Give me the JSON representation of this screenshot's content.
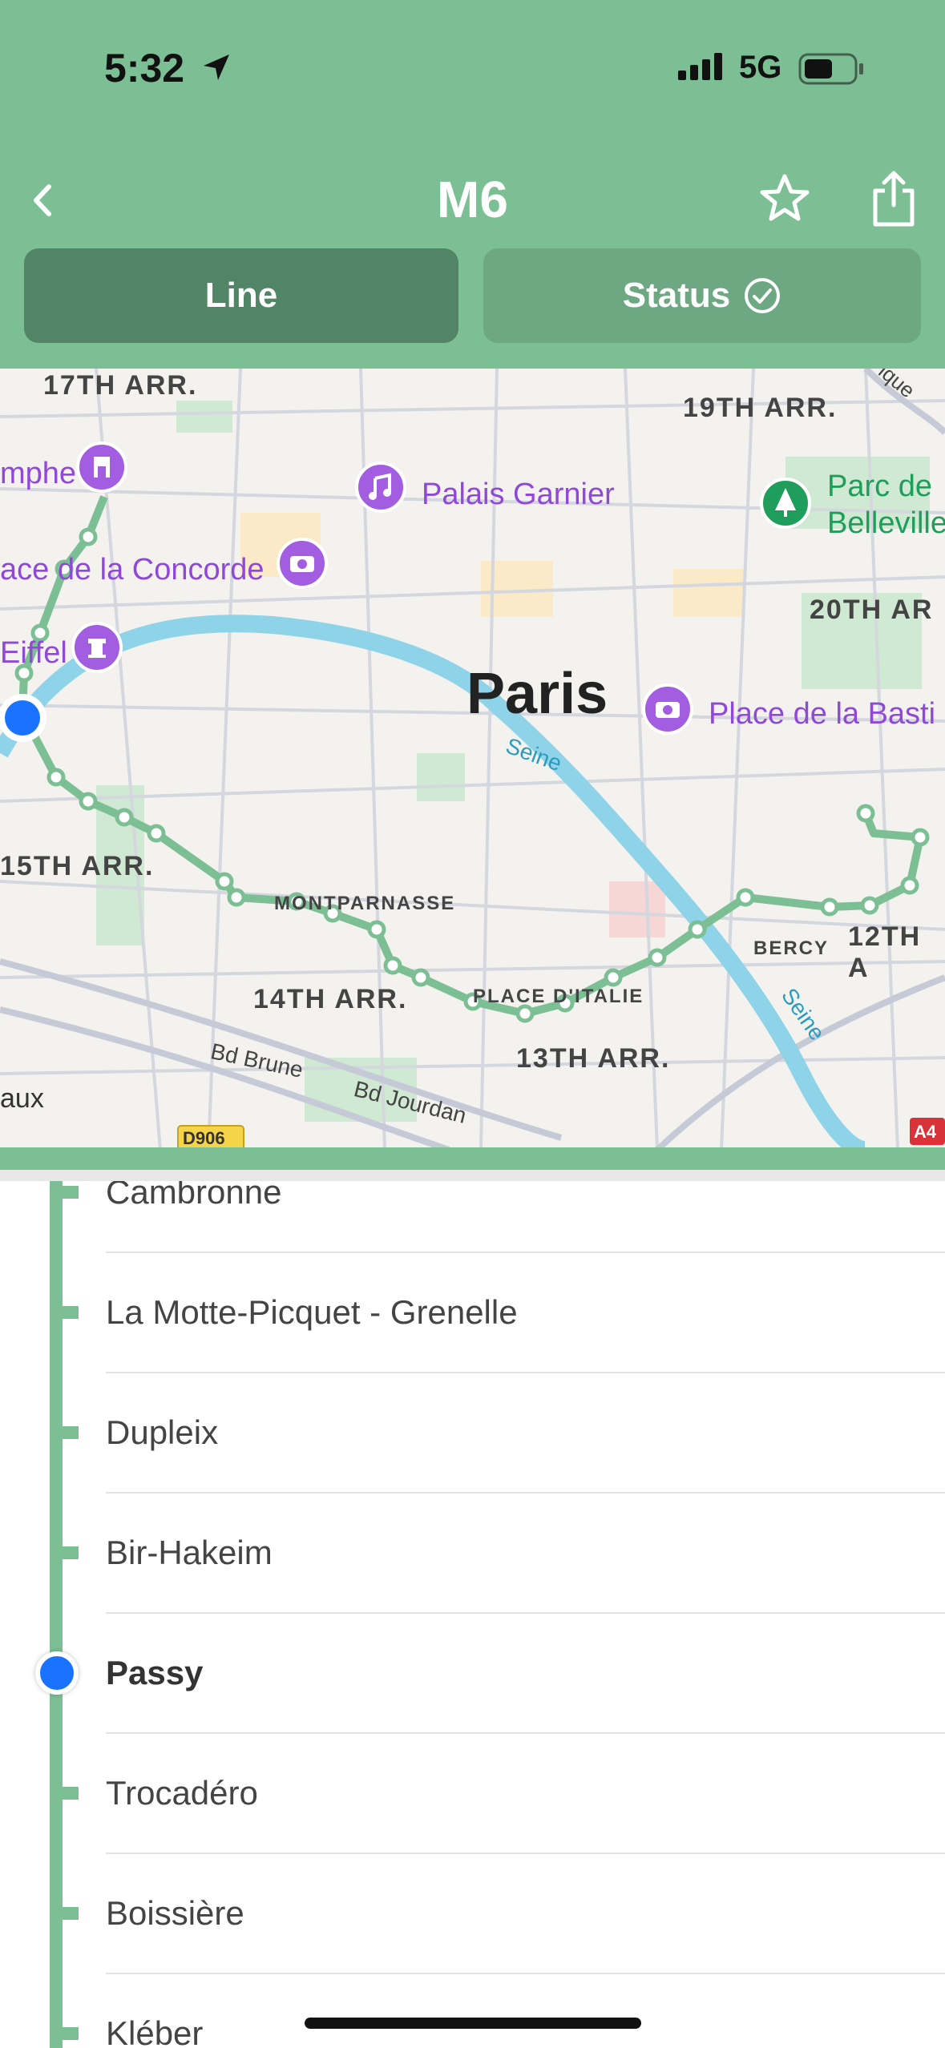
{
  "status_bar": {
    "time": "5:32",
    "network": "5G"
  },
  "nav": {
    "title": "M6"
  },
  "tabs": [
    {
      "label": "Line",
      "selected": true
    },
    {
      "label": "Status",
      "selected": false
    }
  ],
  "map": {
    "districts": [
      "17TH ARR.",
      "19TH ARR.",
      "20TH AR",
      "15TH ARR.",
      "14TH ARR.",
      "13TH ARR.",
      "12TH A"
    ],
    "neighborhoods": [
      "MONTPARNASSE",
      "PLACE D'ITALIE",
      "BERCY"
    ],
    "city": "Paris",
    "rivers": [
      "Seine",
      "Seine"
    ],
    "pois": [
      "Palais Garnier",
      "Parc de",
      "Belleville",
      "ace de la Concorde",
      "Eiffel",
      "Place de la Basti",
      "mphe"
    ],
    "roads": [
      "Bd Brune",
      "Bd Jourdan",
      "D906",
      "A4",
      "aux",
      "ique"
    ]
  },
  "stops": [
    {
      "name": "Cambronne",
      "current": false
    },
    {
      "name": "La Motte-Picquet - Grenelle",
      "current": false
    },
    {
      "name": "Dupleix",
      "current": false
    },
    {
      "name": "Bir-Hakeim",
      "current": false
    },
    {
      "name": "Passy",
      "current": true
    },
    {
      "name": "Trocadéro",
      "current": false
    },
    {
      "name": "Boissière",
      "current": false
    },
    {
      "name": "Kléber",
      "current": false
    }
  ],
  "colors": {
    "line": "#7dbf94",
    "tab_selected": "#528565",
    "tab_unselected": "#6da882",
    "poi": "#a35de0",
    "current": "#1a73ff"
  }
}
